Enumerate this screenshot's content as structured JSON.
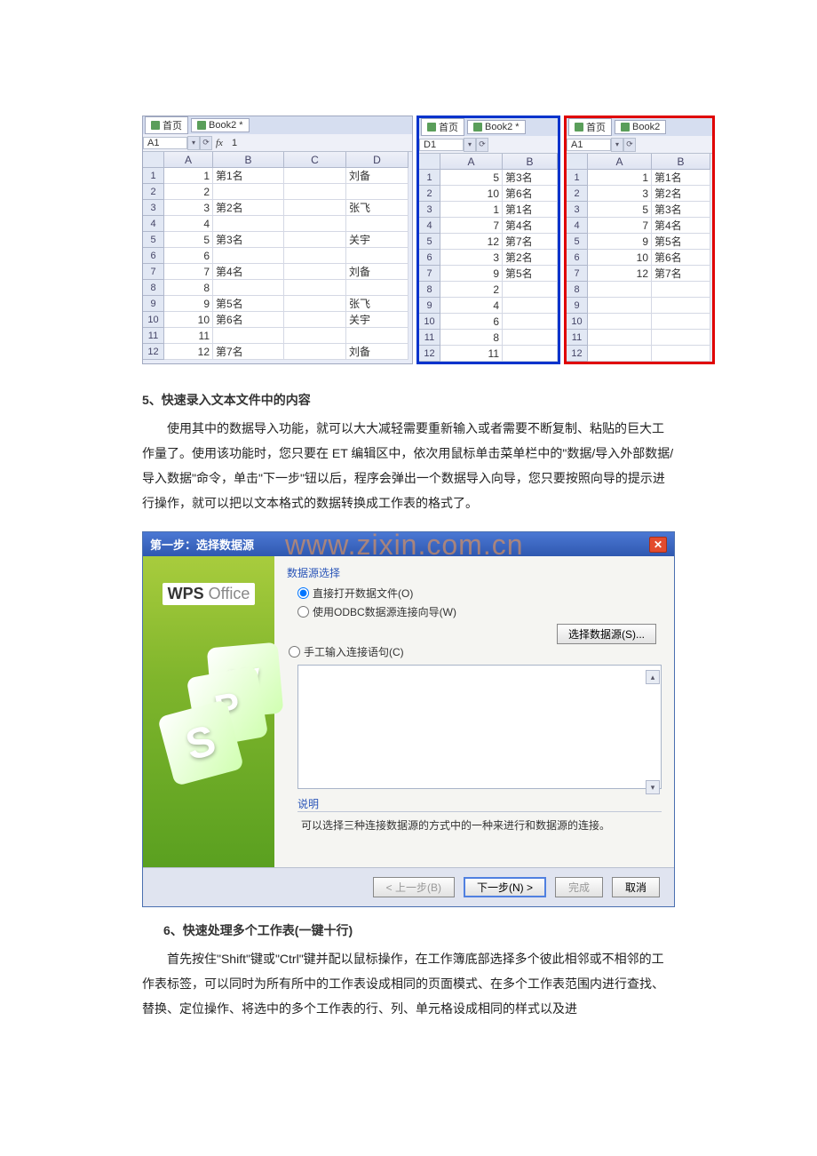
{
  "sheets_top": {
    "sheet1": {
      "tabs": [
        "首页",
        "Book2 *"
      ],
      "cellref": "A1",
      "formula": "1",
      "colheads": [
        "A",
        "B",
        "C",
        "D"
      ],
      "rows": [
        [
          "1",
          "第1名",
          "",
          "刘备"
        ],
        [
          "2",
          "",
          "",
          ""
        ],
        [
          "3",
          "第2名",
          "",
          "张飞"
        ],
        [
          "4",
          "",
          "",
          ""
        ],
        [
          "5",
          "第3名",
          "",
          "关宇"
        ],
        [
          "6",
          "",
          "",
          ""
        ],
        [
          "7",
          "第4名",
          "",
          "刘备"
        ],
        [
          "8",
          "",
          "",
          ""
        ],
        [
          "9",
          "第5名",
          "",
          "张飞"
        ],
        [
          "10",
          "第6名",
          "",
          "关宇"
        ],
        [
          "11",
          "",
          "",
          ""
        ],
        [
          "12",
          "第7名",
          "",
          "刘备"
        ]
      ]
    },
    "sheet2": {
      "tabs": [
        "首页",
        "Book2 *"
      ],
      "cellref": "D1",
      "colheads": [
        "A",
        "B"
      ],
      "rows": [
        [
          "5",
          "第3名"
        ],
        [
          "10",
          "第6名"
        ],
        [
          "1",
          "第1名"
        ],
        [
          "7",
          "第4名"
        ],
        [
          "12",
          "第7名"
        ],
        [
          "3",
          "第2名"
        ],
        [
          "9",
          "第5名"
        ],
        [
          "2",
          ""
        ],
        [
          "4",
          ""
        ],
        [
          "6",
          ""
        ],
        [
          "8",
          ""
        ],
        [
          "11",
          ""
        ]
      ]
    },
    "sheet3": {
      "tabs": [
        "首页",
        "Book2"
      ],
      "cellref": "A1",
      "colheads": [
        "A",
        "B"
      ],
      "rows": [
        [
          "1",
          "第1名"
        ],
        [
          "3",
          "第2名"
        ],
        [
          "5",
          "第3名"
        ],
        [
          "7",
          "第4名"
        ],
        [
          "9",
          "第5名"
        ],
        [
          "10",
          "第6名"
        ],
        [
          "12",
          "第7名"
        ],
        [
          "",
          ""
        ],
        [
          "",
          ""
        ],
        [
          "",
          ""
        ],
        [
          "",
          ""
        ],
        [
          "",
          ""
        ]
      ]
    }
  },
  "watermark": "www.zixin.com.cn",
  "section5": {
    "heading": "5、快速录入文本文件中的内容",
    "p": "使用其中的数据导入功能，就可以大大减轻需要重新输入或者需要不断复制、粘贴的巨大工作量了。使用该功能时，您只要在 ET 编辑区中，依次用鼠标单击菜单栏中的\"数据/导入外部数据/导入数据\"命令，单击\"下一步\"钮以后，程序会弹出一个数据导入向导，您只要按照向导的提示进行操作，就可以把以文本格式的数据转换成工作表的格式了。"
  },
  "dialog": {
    "title": "第一步：选择数据源",
    "group1": "数据源选择",
    "opt1": "直接打开数据文件(O)",
    "opt2": "使用ODBC数据源连接向导(W)",
    "selbtn": "选择数据源(S)...",
    "opt3": "手工输入连接语句(C)",
    "desc_title": "说明",
    "desc_text": "可以选择三种连接数据源的方式中的一种来进行和数据源的连接。",
    "btn_prev": "< 上一步(B)",
    "btn_next": "下一步(N) >",
    "btn_finish": "完成",
    "btn_cancel": "取消",
    "logo_wps": "WPS",
    "logo_office": "Office"
  },
  "section6": {
    "heading": "6、快速处理多个工作表(一键十行)",
    "p": "首先按住\"Shift\"键或\"Ctrl\"键并配以鼠标操作，在工作簿底部选择多个彼此相邻或不相邻的工作表标签，可以同时为所有所中的工作表设成相同的页面模式、在多个工作表范围内进行查找、替换、定位操作、将选中的多个工作表的行、列、单元格设成相同的样式以及进"
  },
  "rownums": [
    "1",
    "2",
    "3",
    "4",
    "5",
    "6",
    "7",
    "8",
    "9",
    "10",
    "11",
    "12"
  ]
}
